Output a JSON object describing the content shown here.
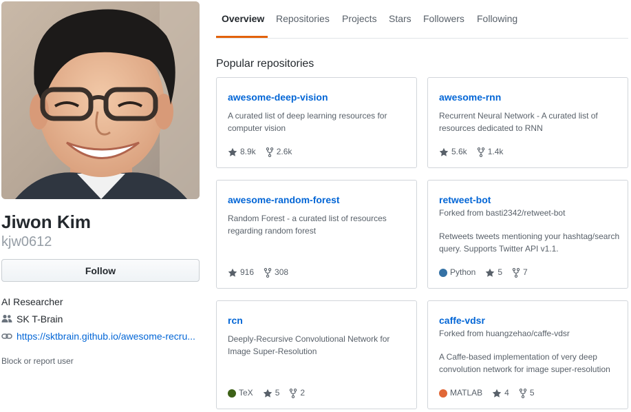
{
  "profile": {
    "fullname": "Jiwon Kim",
    "username": "kjw0612",
    "follow_label": "Follow",
    "bio": "AI Researcher",
    "organization": "SK T-Brain",
    "website": "https://sktbrain.github.io/awesome-recru...",
    "block_label": "Block or report user"
  },
  "nav": {
    "tabs": [
      {
        "label": "Overview",
        "selected": true
      },
      {
        "label": "Repositories"
      },
      {
        "label": "Projects"
      },
      {
        "label": "Stars"
      },
      {
        "label": "Followers"
      },
      {
        "label": "Following"
      }
    ]
  },
  "popular": {
    "title": "Popular repositories",
    "repos": [
      {
        "name": "awesome-deep-vision",
        "forked_from": "",
        "description": "A curated list of deep learning resources for computer vision",
        "language": "",
        "language_color": "",
        "stars": "8.9k",
        "forks": "2.6k"
      },
      {
        "name": "awesome-rnn",
        "forked_from": "",
        "description": "Recurrent Neural Network - A curated list of resources dedicated to RNN",
        "language": "",
        "language_color": "",
        "stars": "5.6k",
        "forks": "1.4k"
      },
      {
        "name": "awesome-random-forest",
        "forked_from": "",
        "description": "Random Forest - a curated list of resources regarding random forest",
        "language": "",
        "language_color": "",
        "stars": "916",
        "forks": "308"
      },
      {
        "name": "retweet-bot",
        "forked_from": "Forked from basti2342/retweet-bot",
        "description": "Retweets tweets mentioning your hashtag/search query. Supports Twitter API v1.1.",
        "language": "Python",
        "language_color": "#3572A5",
        "stars": "5",
        "forks": "7"
      },
      {
        "name": "rcn",
        "forked_from": "",
        "description": "Deeply-Recursive Convolutional Network for Image Super-Resolution",
        "language": "TeX",
        "language_color": "#3D6117",
        "stars": "5",
        "forks": "2"
      },
      {
        "name": "caffe-vdsr",
        "forked_from": "Forked from huangzehao/caffe-vdsr",
        "description": "A Caffe-based implementation of very deep convolution network for image super-resolution",
        "language": "MATLAB",
        "language_color": "#e16737",
        "stars": "4",
        "forks": "5"
      }
    ]
  },
  "icons": {
    "star": "star-icon",
    "fork": "repo-forked-icon",
    "people": "organization-icon",
    "link": "link-icon"
  },
  "colors": {
    "link": "#0366d6",
    "nav_selected_underline": "#e36209",
    "muted": "#586069"
  }
}
